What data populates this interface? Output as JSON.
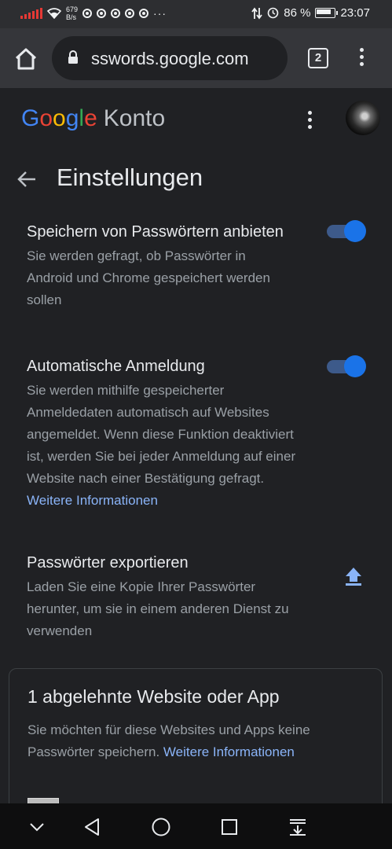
{
  "status_bar": {
    "net_speed_value": "679",
    "net_speed_unit": "B/s",
    "battery_percent": "86 %",
    "time": "23:07",
    "more": "···"
  },
  "browser": {
    "url": "sswords.google.com",
    "tab_count": "2"
  },
  "account_header": {
    "logo_letters": [
      "G",
      "o",
      "o",
      "g",
      "l",
      "e"
    ],
    "product": "Konto"
  },
  "page": {
    "title": "Einstellungen"
  },
  "settings": [
    {
      "title": "Speichern von Passwörtern anbieten",
      "description": "Sie werden gefragt, ob Passwörter in Android und Chrome gespeichert werden sollen",
      "enabled": true
    },
    {
      "title": "Automatische Anmeldung",
      "description": "Sie werden mithilfe gespeicherter Anmeldedaten automatisch auf Websites angemeldet. Wenn diese Funktion deaktiviert ist, werden Sie bei jeder Anmeldung auf einer Website nach einer Bestätigung gefragt.",
      "link": "Weitere Informationen",
      "enabled": true
    },
    {
      "title": "Passwörter exportieren",
      "description": "Laden Sie eine Kopie Ihrer Passwörter herunter, um sie in einem anderen Dienst zu verwenden"
    }
  ],
  "declined_card": {
    "title": "1 abgelehnte Website oder App",
    "description": "Sie möchten für diese Websites und Apps keine Passwörter speichern.",
    "link": "Weitere Informationen"
  },
  "colors": {
    "accent_blue": "#8ab4f8",
    "toggle_on": "#1a73e8",
    "background": "#202124",
    "toolbar": "#35363a"
  },
  "icons": {
    "home": "home-icon",
    "lock": "lock-icon",
    "menu": "more-vert-icon",
    "back": "arrow-back-icon",
    "export": "upload-icon",
    "nav": [
      "chevron-down-icon",
      "back-triangle-icon",
      "home-circle-icon",
      "recents-square-icon",
      "download-tray-icon"
    ]
  }
}
